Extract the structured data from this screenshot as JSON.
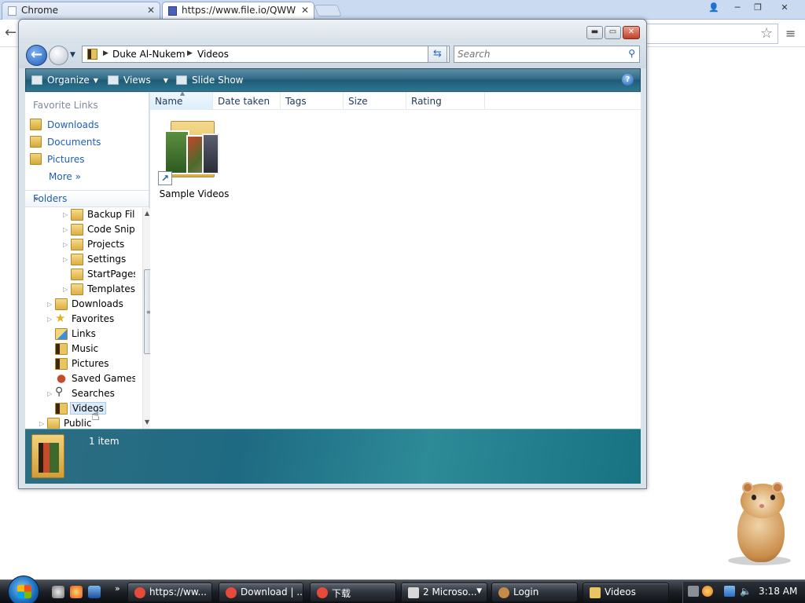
{
  "browser": {
    "tabs": [
      {
        "title": "Chrome",
        "close": "✕"
      },
      {
        "title": "https://www.file.io/QWW",
        "close": "✕"
      }
    ],
    "window_buttons": {
      "user": "👤",
      "minimize": "─",
      "restore": "❐",
      "close": "✕"
    },
    "back_icon": "←",
    "star_icon": "☆",
    "menu_icon": "≡"
  },
  "explorer": {
    "title_buttons": {
      "minimize": "▬",
      "maximize": "▭",
      "close": "✕"
    },
    "address": {
      "crumbs": [
        "Duke Al-Nukem",
        "Videos"
      ],
      "separator": "▶",
      "dropdown": "▼"
    },
    "refresh_icon": "⇆",
    "search": {
      "placeholder": "Search",
      "icon": "⚲"
    },
    "command_bar": {
      "organize": "Organize",
      "views": "Views",
      "slideshow": "Slide Show",
      "help": "?"
    },
    "favorites": {
      "header": "Favorite Links",
      "links": [
        "Downloads",
        "Documents",
        "Pictures"
      ],
      "more": "More »"
    },
    "folders_header": "Folders",
    "tree": [
      {
        "label": "Backup Files",
        "expander": "▷"
      },
      {
        "label": "Code Snippets",
        "expander": "▷"
      },
      {
        "label": "Projects",
        "expander": "▷"
      },
      {
        "label": "Settings",
        "expander": "▷"
      },
      {
        "label": "StartPages",
        "expander": ""
      },
      {
        "label": "Templates",
        "expander": "▷"
      },
      {
        "label": "Downloads",
        "expander": "▷"
      },
      {
        "label": "Favorites",
        "expander": "▷"
      },
      {
        "label": "Links",
        "expander": ""
      },
      {
        "label": "Music",
        "expander": ""
      },
      {
        "label": "Pictures",
        "expander": ""
      },
      {
        "label": "Saved Games",
        "expander": ""
      },
      {
        "label": "Searches",
        "expander": "▷"
      },
      {
        "label": "Videos",
        "expander": ""
      },
      {
        "label": "Public",
        "expander": "▷"
      }
    ],
    "columns": [
      "Name",
      "Date taken",
      "Tags",
      "Size",
      "Rating"
    ],
    "items": [
      {
        "name": "Sample Videos",
        "shortcut_icon": "↗"
      }
    ],
    "status": "1 item"
  },
  "taskbar": {
    "quick_launch_more": "»",
    "buttons": [
      {
        "label": "https://ww...",
        "icon_color": "#e64a3b"
      },
      {
        "label": "Download | ...",
        "icon_color": "#e64a3b"
      },
      {
        "label": "下载",
        "icon_color": "#e64a3b"
      },
      {
        "label": "2 Microso...",
        "icon_color": "#d8d8d8"
      },
      {
        "label": "Login",
        "icon_color": "#c48a4a"
      },
      {
        "label": "Videos",
        "icon_color": "#e8c560"
      }
    ],
    "clock": "3:18 AM"
  },
  "colors": {
    "accent": "#1e5fb0",
    "command_bar": "#2f6b86",
    "details_pane": "#1e6a82"
  }
}
